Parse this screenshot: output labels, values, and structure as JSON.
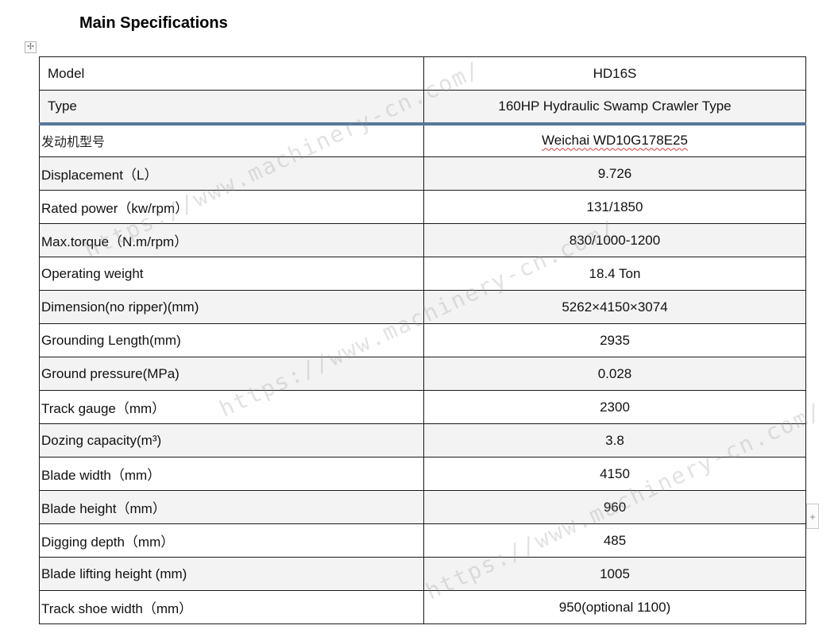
{
  "heading": "Main Specifications",
  "watermark": "https://www.machinery-cn.com/",
  "table": {
    "rows": [
      {
        "label": "Model",
        "value": "HD16S"
      },
      {
        "label": "Type",
        "value": "160HP Hydraulic Swamp Crawler Type"
      },
      {
        "label": "发动机型号",
        "value": "Weichai WD10G178E25"
      },
      {
        "label": "Displacement（L）",
        "value": "9.726"
      },
      {
        "label": "Rated power（kw/rpm）",
        "value": "131/1850"
      },
      {
        "label": "Max.torque（N.m/rpm）",
        "value": "830/1000-1200"
      },
      {
        "label": "Operating weight",
        "value": "18.4 Ton"
      },
      {
        "label": "Dimension(no ripper)(mm)",
        "value": "5262×4150×3074"
      },
      {
        "label": "Grounding Length(mm)",
        "value": "2935"
      },
      {
        "label": "Ground pressure(MPa)",
        "value": "0.028"
      },
      {
        "label": "Track gauge（mm）",
        "value": "2300"
      },
      {
        "label": "Dozing capacity(m³)",
        "value": "3.8"
      },
      {
        "label": "Blade width（mm）",
        "value": "4150"
      },
      {
        "label": "Blade height（mm）",
        "value": "960"
      },
      {
        "label": "Digging depth（mm）",
        "value": "485"
      },
      {
        "label": "Blade lifting height (mm)",
        "value": "1005"
      },
      {
        "label": "Track shoe width（mm）",
        "value": "950(optional 1100)"
      }
    ]
  }
}
